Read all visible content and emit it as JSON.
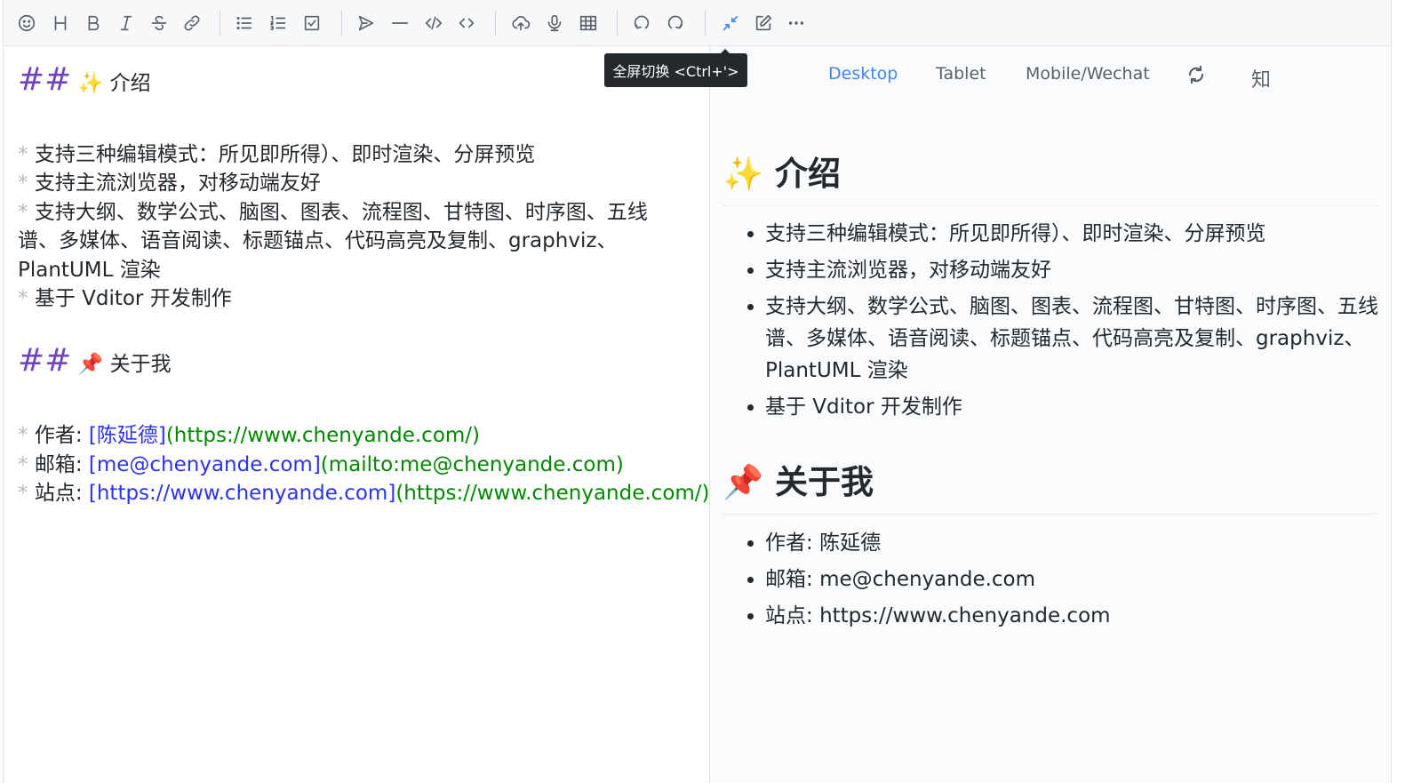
{
  "toolbar": {
    "tooltip": "全屏切换 <Ctrl+'>"
  },
  "editor": {
    "h1_mark": "##",
    "h1_emoji": "✨",
    "h1_text": "介绍",
    "bullet": "*",
    "list1": [
      "支持三种编辑模式：所见即所得）、即时渲染、分屏预览",
      "支持主流浏览器，对移动端友好",
      "支持大纲、数学公式、脑图、图表、流程图、甘特图、时序图、五线",
      "谱、多媒体、语音阅读、标题锚点、代码高亮及复制、graphviz、",
      "PlantUML 渲染",
      "基于 Vditor 开发制作"
    ],
    "h2_mark": "##",
    "h2_emoji": "📌",
    "h2_text": "关于我",
    "about": [
      {
        "label": "作者: ",
        "text": "[陈延德]",
        "url": "(https://www.chenyande.com/)"
      },
      {
        "label": "邮箱: ",
        "text": "[me@chenyande.com]",
        "url": "(mailto:me@chenyande.com)"
      },
      {
        "label": "站点: ",
        "text": "[https://www.chenyande.com]",
        "url": "(https://www.chenyande.com/)"
      }
    ]
  },
  "preview": {
    "tabs": [
      "Desktop",
      "Tablet",
      "Mobile/Wechat"
    ],
    "zhi_label": "知",
    "h1_emoji": "✨",
    "h1_text": "介绍",
    "list1": [
      "支持三种编辑模式：所见即所得）、即时渲染、分屏预览",
      "支持主流浏览器，对移动端友好",
      "支持大纲、数学公式、脑图、图表、流程图、甘特图、时序图、五线谱、多媒体、语音阅读、标题锚点、代码高亮及复制、graphviz、PlantUML 渲染",
      "基于 Vditor 开发制作"
    ],
    "h2_emoji": "📌",
    "h2_text": "关于我",
    "about": [
      {
        "label": "作者: ",
        "value": "陈延德"
      },
      {
        "label": "邮箱: ",
        "value": "me@chenyande.com"
      },
      {
        "label": "站点: ",
        "value": "https://www.chenyande.com"
      }
    ]
  },
  "colors": {
    "accent": "#4285f4",
    "heading_mark": "#6f42c1",
    "link_text": "#2a33f2",
    "link_url": "#008800"
  }
}
